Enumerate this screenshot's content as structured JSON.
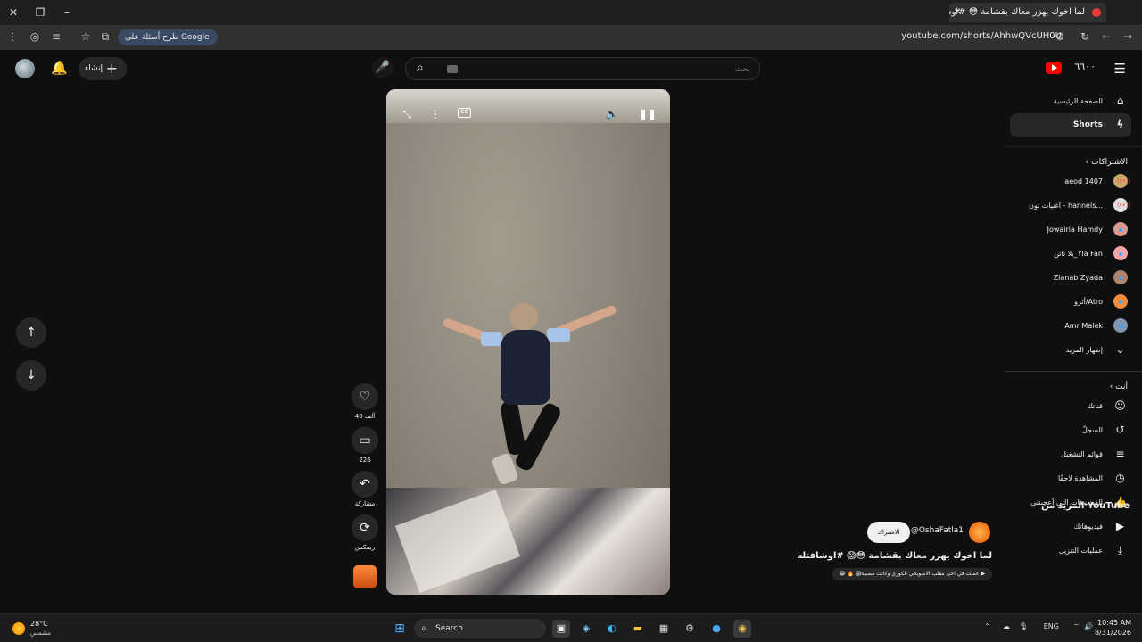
{
  "browser": {
    "tab_title": "لما اخوك يهزر معاك بقشامة 😳 #اوشافتله",
    "url": "youtube.com/shorts/AhhwQVcUH0U",
    "google_pill": "طرح أسئلة على Google"
  },
  "header": {
    "create_label": "إنشاء",
    "search_placeholder": "بحث",
    "logo_text": "٦٦٠٠"
  },
  "sidebar": {
    "home": "الصفحة الرئيسية",
    "shorts": "Shorts",
    "subscriptions_title": "الاشتراكات",
    "subscriptions": [
      {
        "name": "aeod 1407",
        "live": true,
        "color": "#c8a96a"
      },
      {
        "name": "اغنيات تون - hannels...",
        "live": true,
        "color": "#e0e0e0"
      },
      {
        "name": "Jowairia Hamdy",
        "live": false,
        "color": "#d79a8c"
      },
      {
        "name": "يلا تاتن_Yla Fan",
        "live": false,
        "color": "#f4a6a6"
      },
      {
        "name": "Zianab Zyada",
        "live": false,
        "color": "#b0846a"
      },
      {
        "name": "أترو/Atro",
        "live": false,
        "color": "#f28b3c"
      },
      {
        "name": "Amr Malek",
        "live": false,
        "color": "#7f95b0"
      }
    ],
    "show_more": "إظهار المزيد",
    "you_title": "أنت",
    "you_items": [
      {
        "label": "قناتك",
        "icon": "channel-icon"
      },
      {
        "label": "السجلّ",
        "icon": "history-icon"
      },
      {
        "label": "قوائم التشغيل",
        "icon": "playlists-icon"
      },
      {
        "label": "المشاهدة لاحقًا",
        "icon": "watch-later-icon"
      },
      {
        "label": "الفيديوهات التي أعجبتني",
        "icon": "liked-icon"
      },
      {
        "label": "فيديوهاتك",
        "icon": "your-videos-icon"
      },
      {
        "label": "عمليات التنزيل",
        "icon": "downloads-icon"
      }
    ],
    "more_from": "المزيد من YouTube"
  },
  "actions": {
    "likes": "40 ألف",
    "comments": "226",
    "share": "مشاركة",
    "remix": "ريمكس"
  },
  "meta": {
    "channel": "@OshaFatla1",
    "subscribe": "الاشتراك",
    "title": "لما اخوك يهزر معاك بقشامة 😳😱 #اوشافتله",
    "music": "▶ عملت في اخي مقلب الاصوبحي الكوري وكانت مصيبة😱 🔥 😂"
  },
  "taskbar": {
    "temp": "28°C",
    "condition": "مشمس",
    "search": "Search",
    "lang": "ENG",
    "time": "10:45 AM",
    "date": "8/31/2026"
  }
}
